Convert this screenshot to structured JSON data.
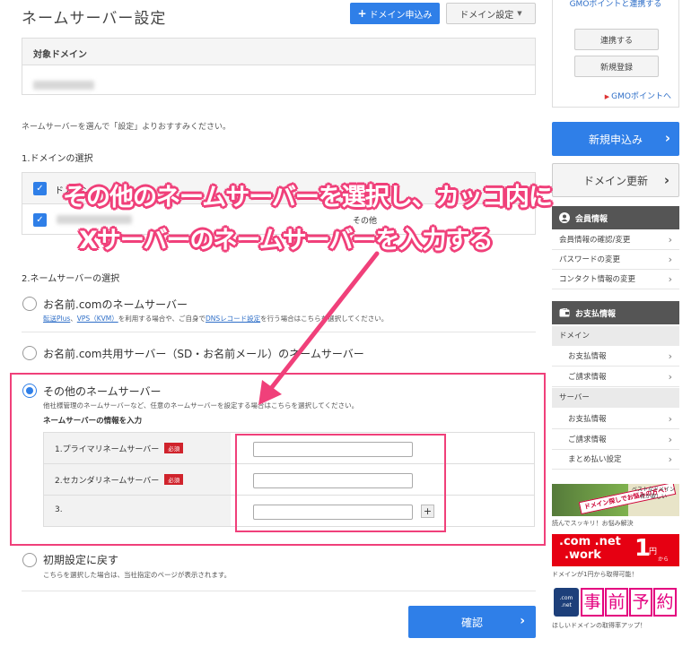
{
  "header": {
    "title": "ネームサーバー設定",
    "apply_button": "ドメイン申込み",
    "settings_button": "ドメイン設定"
  },
  "target": {
    "heading": "対象ドメイン"
  },
  "intro": "ネームサーバーを選んで「設定」よりおすすみください。",
  "domain_select": {
    "heading": "1.ドメインの選択",
    "col1": "ドメイン",
    "row2_value": "その他"
  },
  "ns_select": {
    "heading": "2.ネームサーバーの選択",
    "options": [
      {
        "title": "お名前.comのネームサーバー",
        "sub_link1": "転送Plus",
        "sub_sep": "、",
        "sub_link2": "VPS（KVM）",
        "sub_mid": "を利用する場合や、ご自身で",
        "sub_link3": "DNSレコード設定",
        "sub_end": "を行う場合はこちらを選択してください。"
      },
      {
        "title": "お名前.com共用サーバー（SD・お名前メール）のネームサーバー"
      },
      {
        "title": "その他のネームサーバー",
        "sub": "他社様管理のネームサーバーなど、任意のネームサーバーを設定する場合はこちらを選択してください。",
        "info_heading": "ネームサーバーの情報を入力",
        "rows": [
          {
            "label": "1.プライマリネームサーバー",
            "required": "必須"
          },
          {
            "label": "2.セカンダリネームサーバー",
            "required": "必須"
          },
          {
            "label": "3.",
            "add": "+"
          }
        ]
      },
      {
        "title": "初期設定に戻す",
        "sub": "こちらを選択した場合は、当社指定のページが表示されます。"
      }
    ],
    "selected_index": 2
  },
  "confirm_button": "確認",
  "sidebar": {
    "gmo_title": "GMOポイントと連携する",
    "link_button": "連携する",
    "register_button": "新規登録",
    "gmo_link": "GMOポイントへ",
    "new_apply": "新規申込み",
    "renew": "ドメイン更新",
    "member": {
      "heading": "会員情報",
      "items": [
        "会員情報の確認/変更",
        "パスワードの変更",
        "コンタクト情報の変更"
      ]
    },
    "payment": {
      "heading": "お支払情報",
      "domain_cat": "ドメイン",
      "domain_items": [
        "お支払情報",
        "ご請求情報"
      ],
      "server_cat": "サーバー",
      "server_items": [
        "お支払情報",
        "ご請求情報",
        "まとめ払い設定"
      ]
    },
    "ads": {
      "ad1_band": "ドメイン探しでお悩みの方へ！",
      "ad1_side": "ベストなドメイン名が欲しい",
      "ad1_caption": "読んでスッキリ！お悩み解決",
      "ad2_line1": ".com .net",
      "ad2_line2": ".work",
      "ad2_big": "1",
      "ad2_yen": "円",
      "ad2_kara": "から",
      "ad2_caption": "ドメインが1円から取得可能！",
      "ad3_logo": ".com .net",
      "ad3_chars": [
        "事",
        "前",
        "予",
        "約"
      ],
      "ad3_caption": "ほしいドメインの取得率アップ！"
    }
  },
  "annotation": {
    "line1": "その他のネームサーバーを選択し、カッコ内に",
    "line2": "Xサーバーのネームサーバーを入力する",
    "color": "#f0407a"
  }
}
